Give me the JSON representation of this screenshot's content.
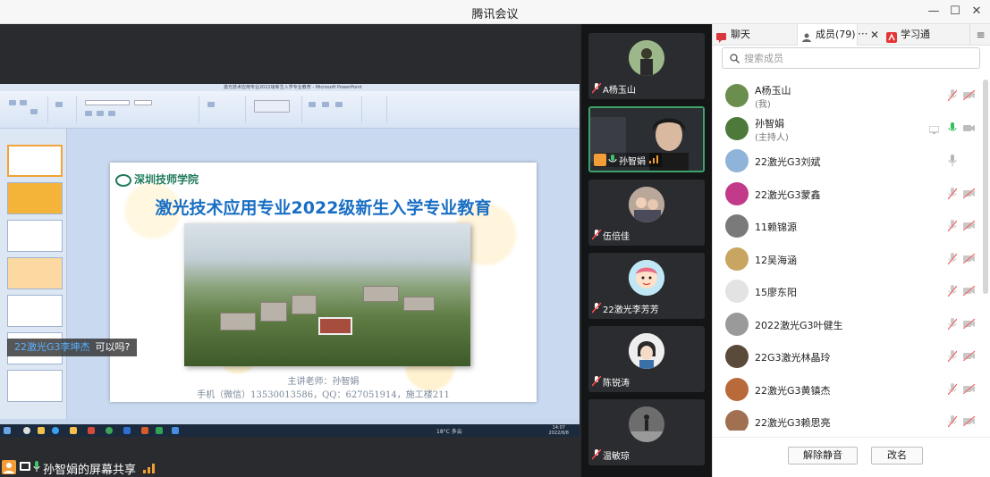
{
  "window": {
    "title": "腾讯会议"
  },
  "shared": {
    "ppt_title": "激光技术应用专业2022级新生入学专业教育 - Microsoft PowerPoint",
    "slide": {
      "logo_text": "深圳技师学院",
      "heading": "激光技术应用专业2022级新生入学专业教育",
      "teacher": "主讲老师：孙智娟",
      "contact": "手机（微信）13530013586，QQ：627051914，施工楼211"
    },
    "taskbar_weather": "18°C 多云",
    "taskbar_time": "14:07",
    "taskbar_date": "2022/8/8"
  },
  "chat_bubble": {
    "sender": "22激光G3李坤杰",
    "message": "可以吗?"
  },
  "share_status": {
    "label": "孙智娟的屏幕共享"
  },
  "tiles": [
    {
      "name": "A杨玉山",
      "kind": "avatar"
    },
    {
      "name": "孙智娟",
      "kind": "video",
      "active": true
    },
    {
      "name": "伍倍佳",
      "kind": "avatar"
    },
    {
      "name": "22激光李芳芳",
      "kind": "avatar"
    },
    {
      "name": "陈锐涛",
      "kind": "avatar"
    },
    {
      "name": "温敏琼",
      "kind": "avatar"
    }
  ],
  "panel": {
    "tabs": [
      {
        "label": "聊天"
      },
      {
        "label": "成员(79)"
      },
      {
        "label": "学习通"
      }
    ],
    "search_placeholder": "搜索成员",
    "members": [
      {
        "name": "A杨玉山",
        "sub": "(我)",
        "mic": "muted",
        "cam": "off",
        "color": "#6b8e4e"
      },
      {
        "name": "孙智娟",
        "sub": "(主持人)",
        "mic": "active",
        "cam": "on",
        "screen": true,
        "color": "#4d7a3a"
      },
      {
        "name": "22激光G3刘斌",
        "mic": "on",
        "cam": "none",
        "color": "#8fb3d9"
      },
      {
        "name": "22激光G3蒙鑫",
        "mic": "muted",
        "cam": "off",
        "color": "#c23a8a"
      },
      {
        "name": "11赖锦源",
        "mic": "muted",
        "cam": "off",
        "color": "#7a7a7a"
      },
      {
        "name": "12吴海涵",
        "mic": "muted",
        "cam": "off",
        "color": "#c8a560"
      },
      {
        "name": "15廖东阳",
        "mic": "muted",
        "cam": "off",
        "color": "#e3e3e3"
      },
      {
        "name": "2022激光G3叶健生",
        "mic": "muted",
        "cam": "off",
        "color": "#9a9a9a"
      },
      {
        "name": "22G3激光林晶玲",
        "mic": "muted",
        "cam": "off",
        "color": "#5a4a3a"
      },
      {
        "name": "22激光G3黄镇杰",
        "mic": "muted",
        "cam": "off",
        "color": "#b86a3a"
      },
      {
        "name": "22激光G3赖思亮",
        "mic": "muted",
        "cam": "off",
        "color": "#a07050"
      }
    ],
    "unmute_btn": "解除静音",
    "rename_btn": "改名"
  }
}
